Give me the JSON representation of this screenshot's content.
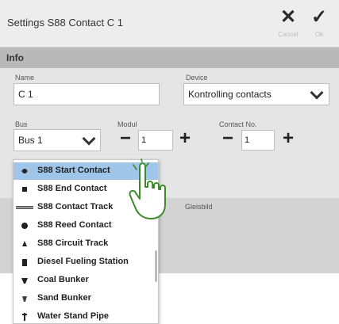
{
  "window": {
    "title": "Settings S88 Contact C 1"
  },
  "toolbar": {
    "cancel_label": "Cancel",
    "ok_label": "Ok"
  },
  "section": {
    "title": "Info"
  },
  "form": {
    "name_label": "Name",
    "name_value": "C 1",
    "device_label": "Device",
    "device_value": "Kontrolling contacts",
    "bus_label": "Bus",
    "bus_value": "Bus 1",
    "modul_label": "Modul",
    "modul_value": "1",
    "contact_label": "Contact No.",
    "contact_value": "1",
    "gleisbild_label": "Gleisbild"
  },
  "dropdown": {
    "items": [
      {
        "label": "S88 Start Contact",
        "icon": "start-contact-icon",
        "selected": true
      },
      {
        "label": "S88 End Contact",
        "icon": "end-contact-icon",
        "selected": false
      },
      {
        "label": "S88 Contact Track",
        "icon": "contact-track-icon",
        "selected": false
      },
      {
        "label": "S88 Reed Contact",
        "icon": "reed-contact-icon",
        "selected": false
      },
      {
        "label": "S88 Circuit Track",
        "icon": "circuit-track-icon",
        "selected": false
      },
      {
        "label": "Diesel Fueling Station",
        "icon": "diesel-station-icon",
        "selected": false
      },
      {
        "label": "Coal Bunker",
        "icon": "coal-bunker-icon",
        "selected": false
      },
      {
        "label": "Sand Bunker",
        "icon": "sand-bunker-icon",
        "selected": false
      },
      {
        "label": "Water Stand Pipe",
        "icon": "water-pipe-icon",
        "selected": false
      }
    ]
  },
  "colors": {
    "selected_item": "#9fc6e8",
    "header": "#b9b9b9",
    "panel": "#e5e5e5",
    "hand_stroke": "#3d8a2a"
  }
}
